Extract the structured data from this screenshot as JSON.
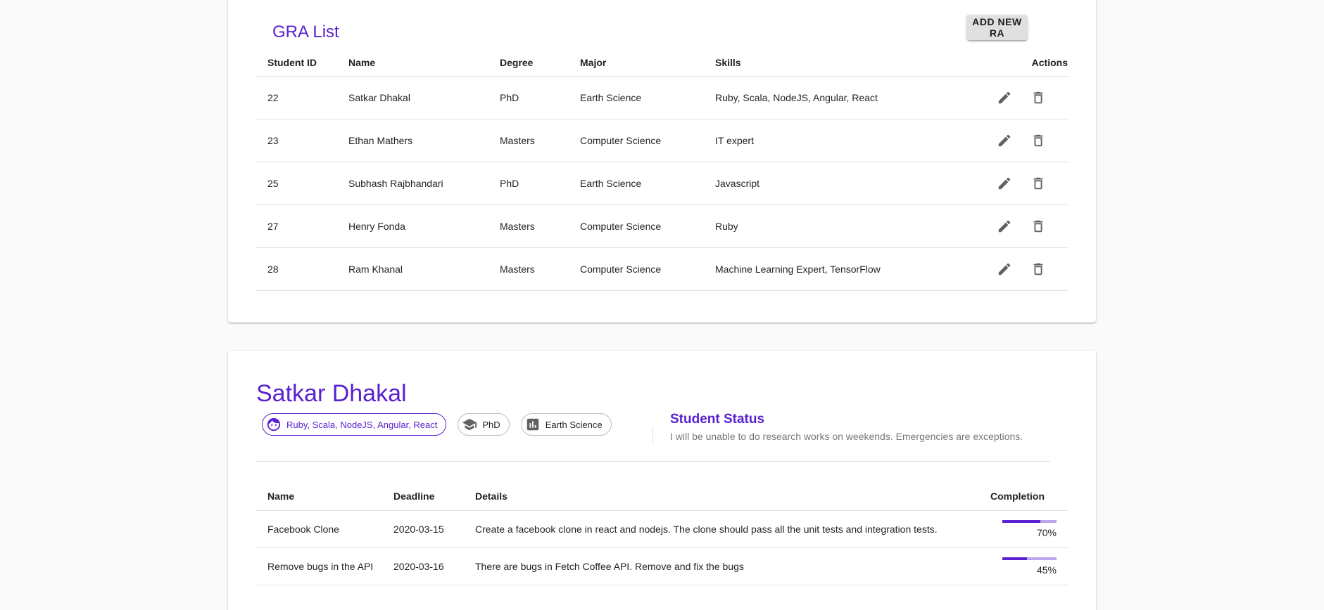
{
  "gra_list": {
    "title": "GRA List",
    "add_button": "ADD NEW RA",
    "columns": [
      "Student ID",
      "Name",
      "Degree",
      "Major",
      "Skills",
      "Actions"
    ],
    "rows": [
      {
        "id": "22",
        "name": "Satkar Dhakal",
        "degree": "PhD",
        "major": "Earth Science",
        "skills": "Ruby, Scala, NodeJS, Angular, React"
      },
      {
        "id": "23",
        "name": "Ethan Mathers",
        "degree": "Masters",
        "major": "Computer Science",
        "skills": "IT expert"
      },
      {
        "id": "25",
        "name": "Subhash Rajbhandari",
        "degree": "PhD",
        "major": "Earth Science",
        "skills": "Javascript"
      },
      {
        "id": "27",
        "name": "Henry Fonda",
        "degree": "Masters",
        "major": "Computer Science",
        "skills": "Ruby"
      },
      {
        "id": "28",
        "name": "Ram Khanal",
        "degree": "Masters",
        "major": "Computer Science",
        "skills": "Machine Learning Expert, TensorFlow"
      }
    ],
    "row_icons": [
      "pencil-icon",
      "trash-icon"
    ]
  },
  "student": {
    "name": "Satkar Dhakal",
    "chips": [
      {
        "label": "Ruby, Scala, NodeJS, Angular, React",
        "icon": "face-icon",
        "primary": true
      },
      {
        "label": "PhD",
        "icon": "graduation-cap-icon",
        "primary": false
      },
      {
        "label": "Earth Science",
        "icon": "bar-chart-icon",
        "primary": false
      }
    ],
    "status_title": "Student Status",
    "status_text": "I will be unable to do research works on weekends. Emergencies are exceptions.",
    "task_columns": [
      "Name",
      "Deadline",
      "Details",
      "Completion"
    ],
    "tasks": [
      {
        "name": "Facebook Clone",
        "deadline": "2020-03-15",
        "details": "Create a facebook clone in react and nodejs. The clone should pass all the unit tests and integration tests.",
        "completion": 70,
        "completion_label": "70%"
      },
      {
        "name": "Remove bugs in the API",
        "deadline": "2020-03-16",
        "details": "There are bugs in Fetch Coffee API. Remove and fix the bugs",
        "completion": 45,
        "completion_label": "45%"
      }
    ]
  },
  "colors": {
    "primary": "#5b21d0",
    "progress_track": "#b9a5ec",
    "background": "#fafafa"
  }
}
